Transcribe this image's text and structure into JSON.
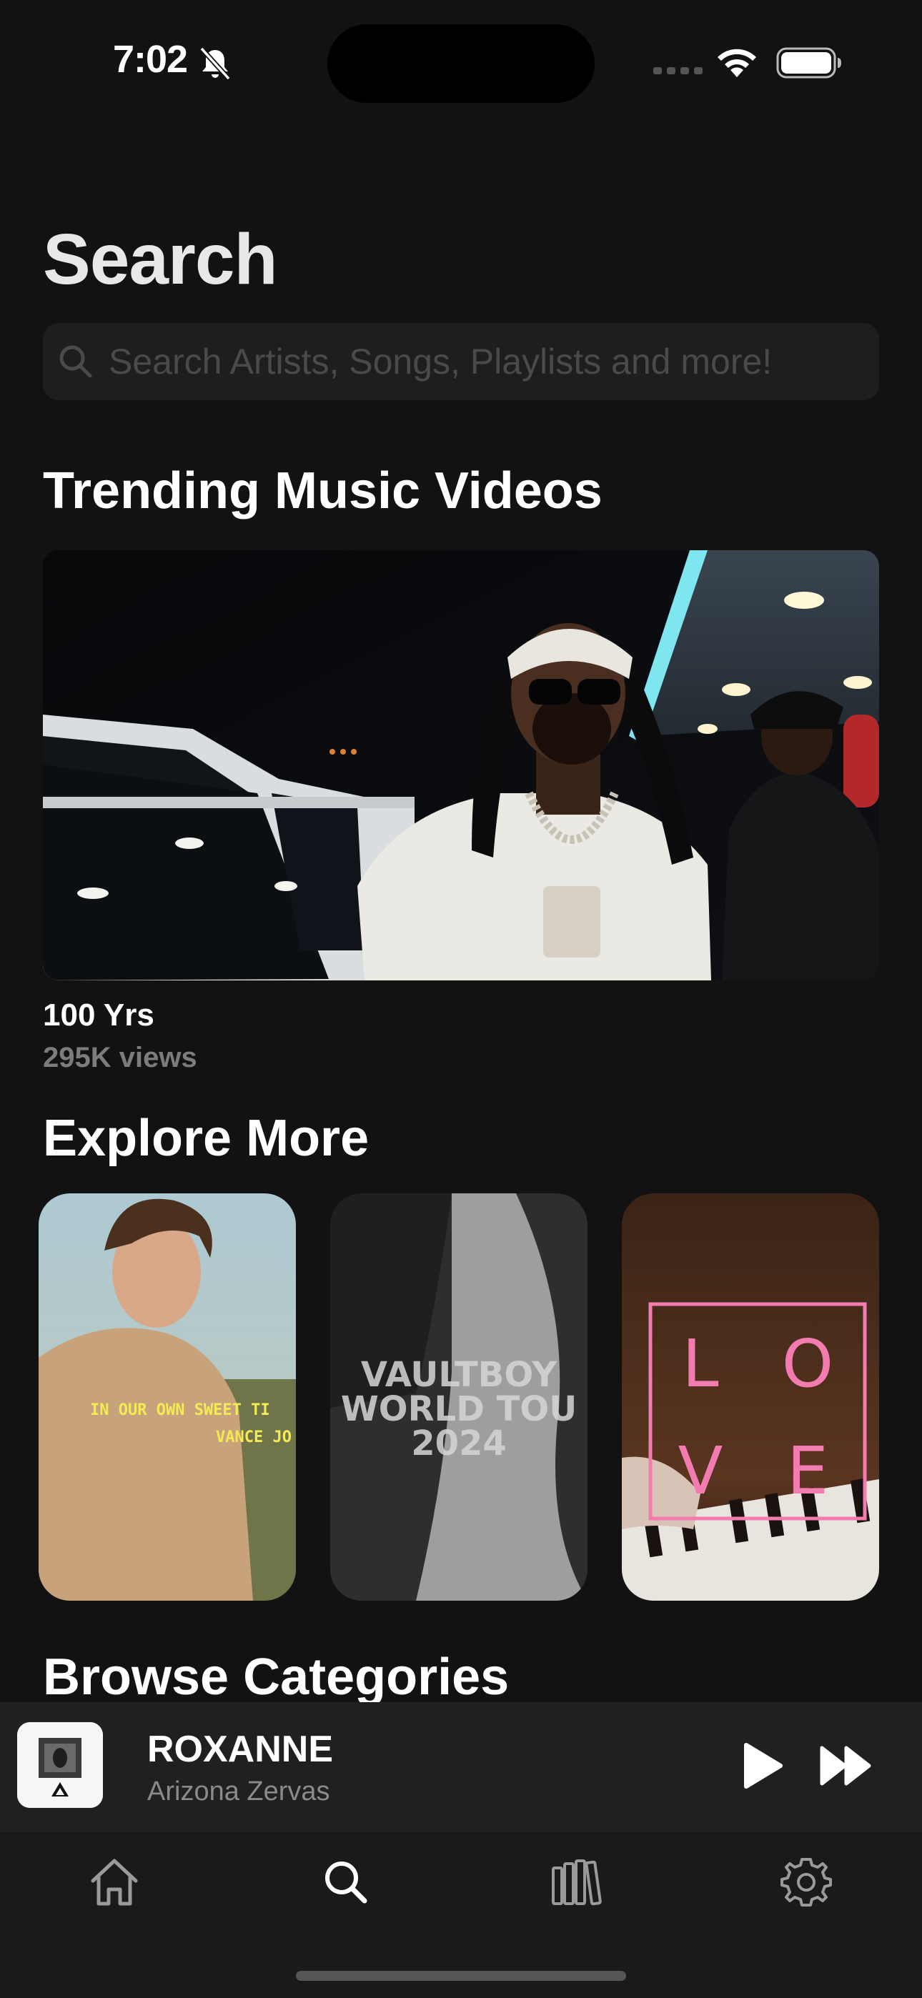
{
  "status_bar": {
    "time": "7:02"
  },
  "page": {
    "title": "Search"
  },
  "search": {
    "placeholder": "Search Artists, Songs, Playlists and more!"
  },
  "trending": {
    "section_title": "Trending Music Videos",
    "video": {
      "title": "100 Yrs",
      "views": "295K views"
    }
  },
  "explore": {
    "section_title": "Explore More",
    "cards": [
      {
        "overlay_line1": "IN OUR OWN SWEET TI",
        "overlay_line2": "VANCE JO"
      },
      {
        "overlay_line1": "VAULTBOY",
        "overlay_line2": "WORLD TOU",
        "overlay_line3": "2024"
      },
      {
        "letters": [
          "L",
          "O",
          "V",
          "E"
        ]
      }
    ]
  },
  "browse": {
    "section_title": "Browse Categories"
  },
  "now_playing": {
    "title": "ROXANNE",
    "artist": "Arizona Zervas"
  },
  "tab_bar": {
    "items": [
      "home-icon",
      "search-icon",
      "library-icon",
      "settings-icon"
    ],
    "active": "search-icon"
  },
  "colors": {
    "background": "#121212",
    "search_field": "#1e1e1e",
    "mini_player": "#202020",
    "tab_bar": "#1a1a1a",
    "love_pink": "#f27bb0"
  }
}
